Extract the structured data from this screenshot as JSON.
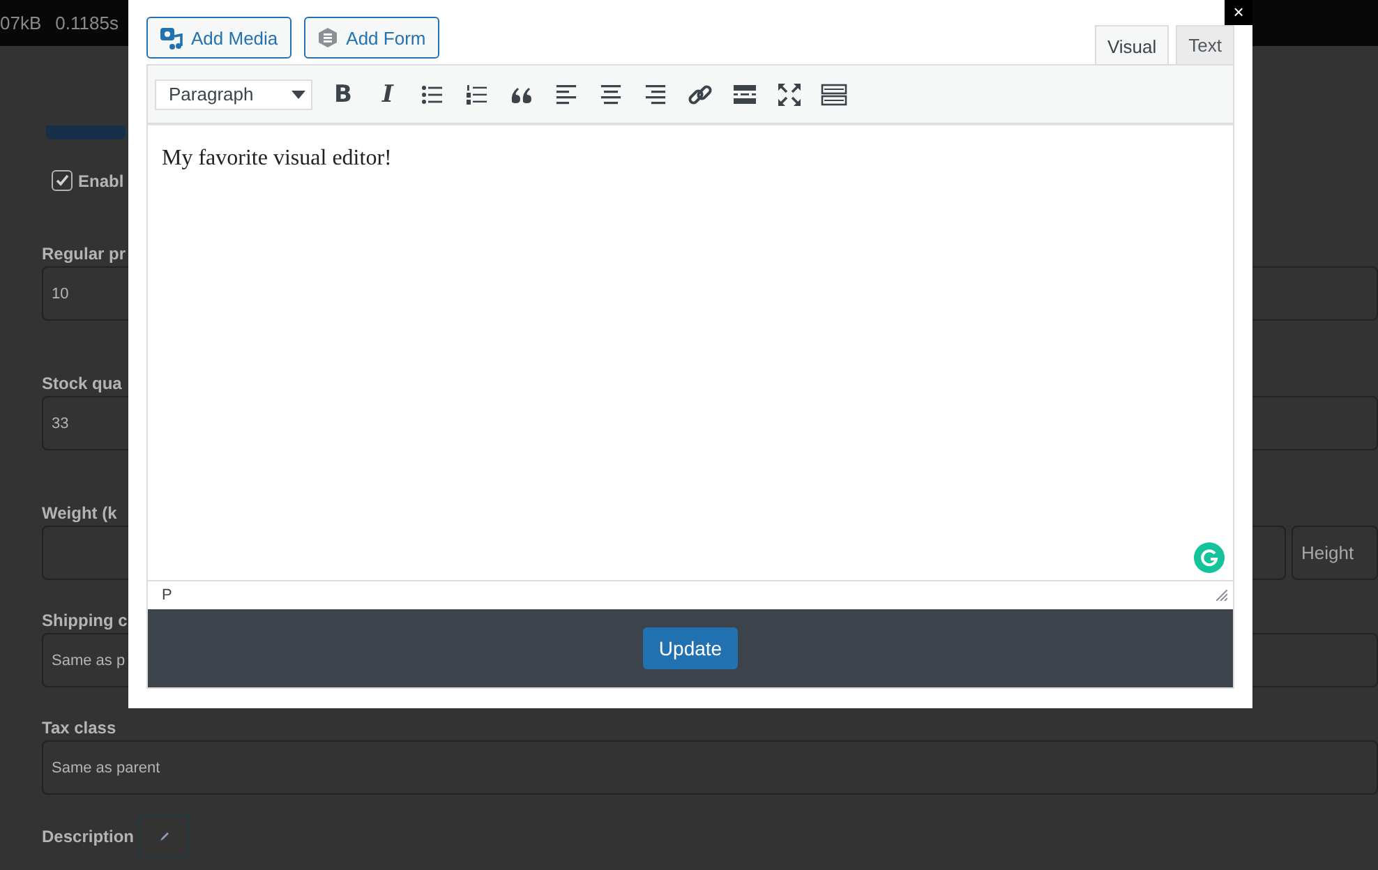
{
  "background": {
    "status_bar": {
      "size": "07kB",
      "time": "0.1185s"
    },
    "checkbox": {
      "label": "Enabl",
      "checked": true
    },
    "fields": [
      {
        "label": "Regular pr",
        "value": "10"
      },
      {
        "label": "Stock qua",
        "value": "33"
      },
      {
        "label": "Weight (k",
        "extra_placeholder": "Height"
      },
      {
        "label": "Shipping c",
        "value": "Same as p"
      },
      {
        "label": "Tax class",
        "value": "Same as parent"
      }
    ],
    "description_label": "Description"
  },
  "modal": {
    "close": "×",
    "media_buttons": [
      {
        "kind": "media",
        "label": "Add Media"
      },
      {
        "kind": "form",
        "label": "Add Form"
      }
    ],
    "tabs": [
      {
        "label": "Visual",
        "selected": true
      },
      {
        "label": "Text",
        "selected": false
      }
    ],
    "format_select": "Paragraph",
    "toolbar": [
      {
        "kind": "glyph",
        "glyph": "B"
      },
      {
        "kind": "glyph",
        "glyph": "I"
      },
      {
        "kind": "bullets"
      },
      {
        "kind": "numbers"
      },
      {
        "kind": "quote"
      },
      {
        "kind": "align-left"
      },
      {
        "kind": "align-center"
      },
      {
        "kind": "align-right"
      },
      {
        "kind": "link"
      },
      {
        "kind": "more"
      },
      {
        "kind": "fullscreen"
      },
      {
        "kind": "kitchen-sink"
      }
    ],
    "content": "My favorite visual editor!",
    "path": "P",
    "submit": "Update"
  }
}
